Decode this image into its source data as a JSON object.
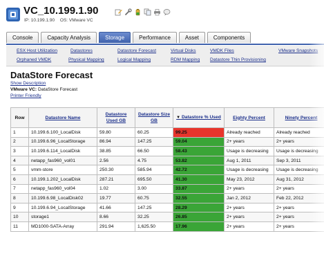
{
  "header": {
    "title": "VC_10.199.1.90",
    "ip": "IP: 10.199.1.90",
    "os": "OS: VMware VC",
    "toolbar_icons": [
      "edit-icon",
      "wrench-icon",
      "battery-icon",
      "copy-icon",
      "print-icon",
      "chat-icon"
    ]
  },
  "tabs": [
    {
      "label": "Console",
      "active": false
    },
    {
      "label": "Capacity Analysis",
      "active": false
    },
    {
      "label": "Storage",
      "active": true
    },
    {
      "label": "Performance",
      "active": false
    },
    {
      "label": "Asset",
      "active": false
    },
    {
      "label": "Components",
      "active": false
    }
  ],
  "subnav": {
    "row1": [
      "ESX Host Utilization",
      "Datastores",
      "Datastore Forecast",
      "Virtual Disks",
      "VMDK Files",
      "VMware Snapshots"
    ],
    "row2": [
      "Orphaned VMDK",
      "Physical Mapping",
      "Logical Mapping",
      "RDM Mapping",
      "Datastore Thin Provisioning"
    ]
  },
  "page": {
    "title": "DataStore Forecast",
    "show_description": "Show Description",
    "vc_label": "VMware VC:",
    "vc_value": "DataStore Forecast",
    "printer_friendly": "Printer Friendly"
  },
  "table": {
    "headers": [
      "Row",
      "Datastore Name",
      "Datastore Used GB",
      "Datastore Size GB",
      "Datastore % Used",
      "Eighty Percent",
      "Ninety Percent"
    ],
    "sort_indicator": "▼",
    "rows": [
      {
        "row": "1",
        "name": "10.199.6.100_LocalDisk",
        "used": "59.80",
        "size": "60.25",
        "pct": "99.25",
        "eighty": "Already reached",
        "ninety": "Already reached",
        "status": "red"
      },
      {
        "row": "2",
        "name": "10.199.6.96_LocalStorage",
        "used": "86.94",
        "size": "147.25",
        "pct": "59.04",
        "eighty": "2+ years",
        "ninety": "2+ years",
        "status": "green"
      },
      {
        "row": "3",
        "name": "10.199.6.114_LocalDisk",
        "used": "38.85",
        "size": "66.50",
        "pct": "58.43",
        "eighty": "Usage is decreasing",
        "ninety": "Usage is decreasing",
        "status": "green"
      },
      {
        "row": "4",
        "name": "netapp_fas960_vol01",
        "used": "2.56",
        "size": "4.75",
        "pct": "53.82",
        "eighty": "Aug 1, 2011",
        "ninety": "Sep 3, 2011",
        "status": "green"
      },
      {
        "row": "5",
        "name": "vmm-store",
        "used": "250.30",
        "size": "585.94",
        "pct": "42.72",
        "eighty": "Usage is decreasing",
        "ninety": "Usage is decreasing",
        "status": "green"
      },
      {
        "row": "6",
        "name": "10.199.1.202_LocalDisk",
        "used": "287.21",
        "size": "695.50",
        "pct": "41.30",
        "eighty": "May 23, 2012",
        "ninety": "Aug 31, 2012",
        "status": "green"
      },
      {
        "row": "7",
        "name": "netapp_fas960_vol04",
        "used": "1.02",
        "size": "3.00",
        "pct": "33.87",
        "eighty": "2+ years",
        "ninety": "2+ years",
        "status": "green"
      },
      {
        "row": "8",
        "name": "10.199.6.98_LocalDisk02",
        "used": "19.77",
        "size": "60.75",
        "pct": "32.55",
        "eighty": "Jan 2, 2012",
        "ninety": "Feb 22, 2012",
        "status": "green"
      },
      {
        "row": "9",
        "name": "10.199.6.94_LocalStorage",
        "used": "41.66",
        "size": "147.25",
        "pct": "28.29",
        "eighty": "2+ years",
        "ninety": "2+ years",
        "status": "green"
      },
      {
        "row": "10",
        "name": "storage1",
        "used": "8.66",
        "size": "32.25",
        "pct": "26.85",
        "eighty": "2+ years",
        "ninety": "2+ years",
        "status": "green"
      },
      {
        "row": "11",
        "name": "MD1000-SATA-Array",
        "used": "291.94",
        "size": "1,625.50",
        "pct": "17.96",
        "eighty": "2+ years",
        "ninety": "2+ years",
        "status": "green"
      }
    ]
  },
  "colors": {
    "tab_active": "#3f62ad",
    "link": "#1a2e8a",
    "pct_red": "#e8352c",
    "pct_green": "#3aa537"
  }
}
